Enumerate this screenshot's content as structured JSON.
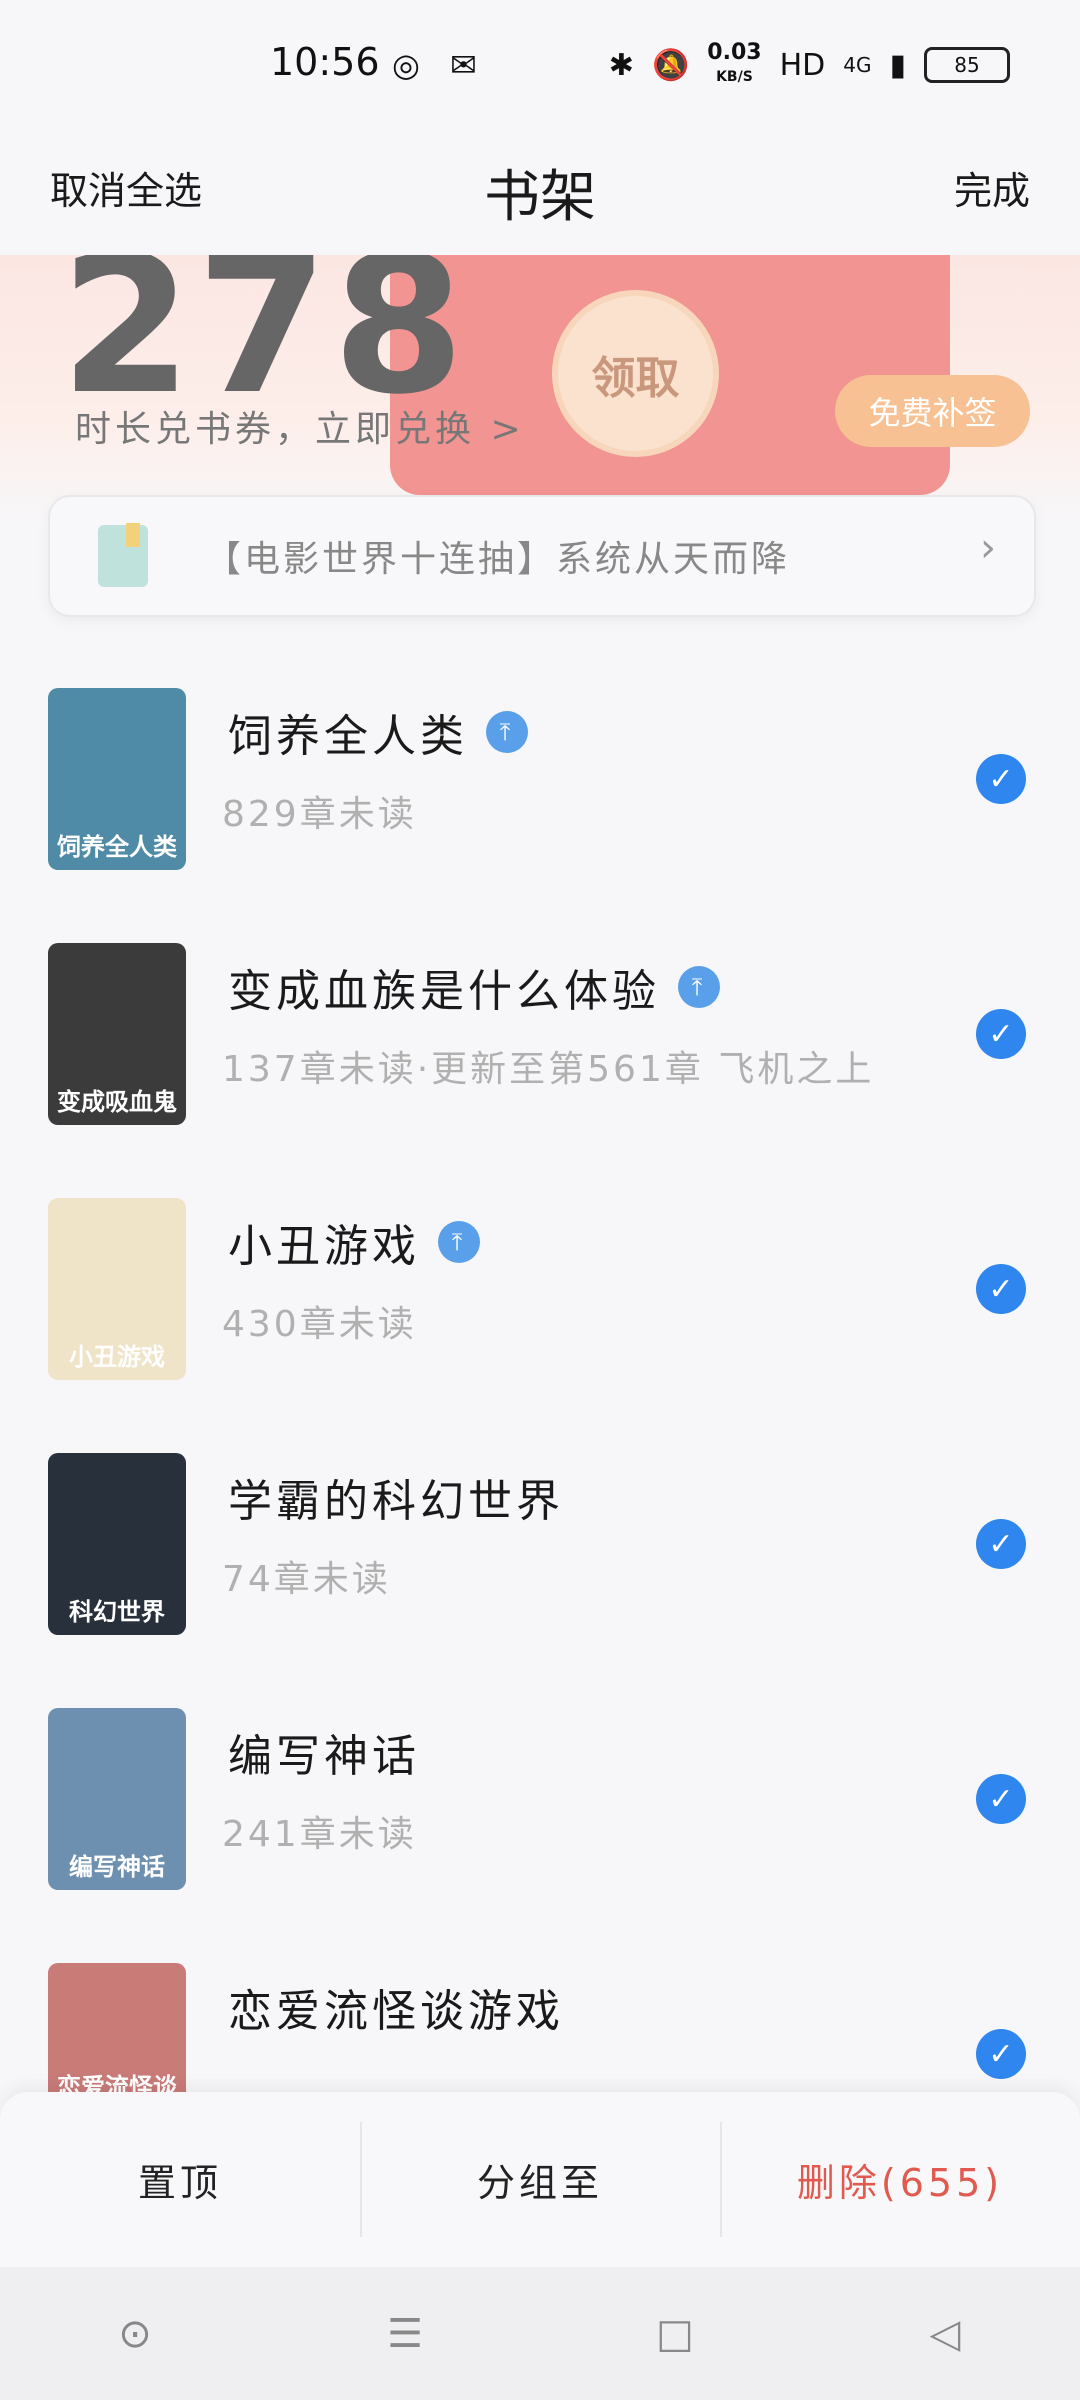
{
  "status_bar": {
    "time": "10:56",
    "speed_value": "0.03",
    "speed_unit": "KB/S",
    "hd": "HD",
    "network": "4G",
    "battery": "85"
  },
  "header": {
    "left": "取消全选",
    "title": "书架",
    "right": "完成"
  },
  "banner": {
    "big_number": "278",
    "claim_label": "领取",
    "subtitle": "时长兑书券，立即兑换 >",
    "free_sign_label": "免费补签"
  },
  "notice": {
    "text": "【电影世界十连抽】系统从天而降"
  },
  "books": [
    {
      "title": "饲养全人类",
      "subtitle": "829章未读",
      "pinned": true,
      "cover_text": "饲养全人类",
      "cover_color": "#4f8aa7"
    },
    {
      "title": "变成血族是什么体验",
      "subtitle": "137章未读·更新至第561章 飞机之上",
      "pinned": true,
      "cover_text": "变成吸血鬼",
      "cover_color": "#3b3b3b"
    },
    {
      "title": "小丑游戏",
      "subtitle": "430章未读",
      "pinned": true,
      "cover_text": "小丑游戏",
      "cover_color": "#efe3c8"
    },
    {
      "title": "学霸的科幻世界",
      "subtitle": "74章未读",
      "pinned": false,
      "cover_text": "科幻世界",
      "cover_color": "#27303b"
    },
    {
      "title": "编写神话",
      "subtitle": "241章未读",
      "pinned": false,
      "cover_text": "编写神话",
      "cover_color": "#6d8fb0"
    },
    {
      "title": "恋爱流怪谈游戏",
      "subtitle": "",
      "pinned": false,
      "cover_text": "恋爱流怪谈游戏",
      "cover_color": "#c97b78"
    }
  ],
  "actions": {
    "pin_label": "置顶",
    "group_label": "分组至",
    "delete_label": "删除(655)"
  },
  "colors": {
    "accent": "#2f86ee",
    "delete": "#e05a4f",
    "pin": "#5a9fe9"
  }
}
